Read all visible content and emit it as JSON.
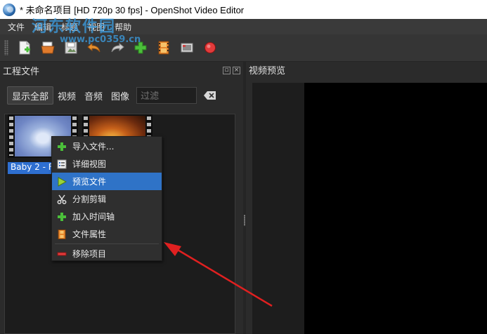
{
  "window": {
    "title": "* 未命名项目 [HD 720p 30 fps] - OpenShot Video Editor",
    "icon": "openshot-logo-icon"
  },
  "menubar": {
    "items": [
      "文件",
      "编辑",
      "标题",
      "视图",
      "帮助"
    ]
  },
  "toolbar": {
    "buttons": [
      {
        "name": "new-project",
        "icon": "new-file-icon"
      },
      {
        "name": "open-project",
        "icon": "open-folder-icon"
      },
      {
        "name": "save-project",
        "icon": "save-icon"
      },
      {
        "name": "undo",
        "icon": "undo-icon"
      },
      {
        "name": "redo",
        "icon": "redo-icon"
      },
      {
        "name": "import-files",
        "icon": "add-icon"
      },
      {
        "name": "choose-profile",
        "icon": "film-icon"
      },
      {
        "name": "fullscreen",
        "icon": "fullscreen-icon"
      },
      {
        "name": "export-video",
        "icon": "record-icon"
      }
    ]
  },
  "watermark": {
    "line1": "河东软件园",
    "line2": "www.pc0359.cn"
  },
  "project_files": {
    "title": "工程文件",
    "filters": [
      "显示全部",
      "视频",
      "音频",
      "图像"
    ],
    "active_filter": "显示全部",
    "search_placeholder": "过滤",
    "files": [
      {
        "label": "Baby 2 - F",
        "selected": true
      },
      {
        "label": "",
        "selected": false
      }
    ]
  },
  "video_preview": {
    "title": "视频预览"
  },
  "context_menu": {
    "items": [
      {
        "label": "导入文件...",
        "icon": "add-icon"
      },
      {
        "label": "详细视图",
        "icon": "details-view-icon"
      },
      {
        "label": "预览文件",
        "icon": "play-icon",
        "highlighted": true
      },
      {
        "label": "分割剪辑",
        "icon": "scissors-icon"
      },
      {
        "label": "加入时间轴",
        "icon": "add-icon"
      },
      {
        "label": "文件属性",
        "icon": "film-icon"
      },
      {
        "label": "移除项目",
        "icon": "remove-icon"
      }
    ]
  },
  "colors": {
    "accent_highlight": "#2f73c7",
    "annotation_arrow": "#e02020",
    "add_green": "#4bbf3a",
    "record_red": "#e23b3b"
  }
}
